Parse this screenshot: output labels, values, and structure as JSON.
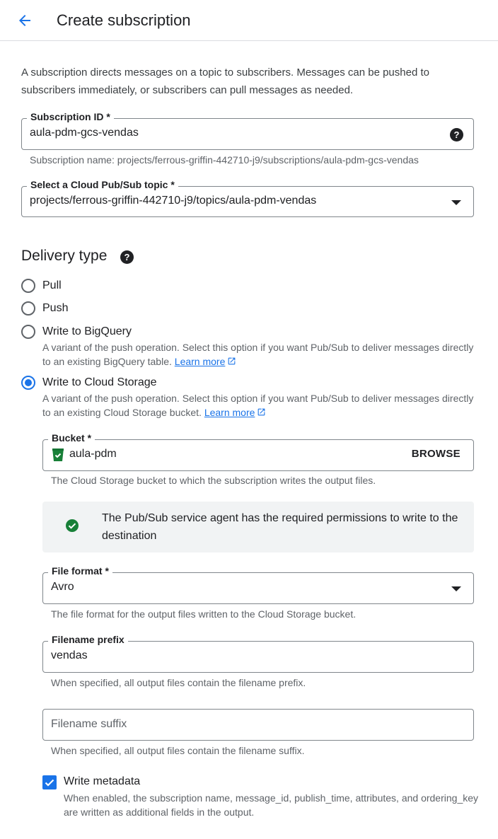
{
  "header": {
    "title": "Create subscription"
  },
  "intro": "A subscription directs messages on a topic to subscribers. Messages can be pushed to subscribers immediately, or subscribers can pull messages as needed.",
  "subscription_id": {
    "label": "Subscription ID *",
    "value": "aula-pdm-gcs-vendas",
    "hint": "Subscription name: projects/ferrous-griffin-442710-j9/subscriptions/aula-pdm-gcs-vendas"
  },
  "topic": {
    "label": "Select a Cloud Pub/Sub topic *",
    "value": "projects/ferrous-griffin-442710-j9/topics/aula-pdm-vendas"
  },
  "delivery": {
    "title": "Delivery type",
    "options": [
      {
        "label": "Pull",
        "checked": false
      },
      {
        "label": "Push",
        "checked": false
      },
      {
        "label": "Write to BigQuery",
        "checked": false,
        "description": "A variant of the push operation. Select this option if you want Pub/Sub to deliver messages directly to an existing BigQuery table.",
        "link": "Learn more"
      },
      {
        "label": "Write to Cloud Storage",
        "checked": true,
        "description": "A variant of the push operation. Select this option if you want Pub/Sub to deliver messages directly to an existing Cloud Storage bucket.",
        "link": "Learn more"
      }
    ]
  },
  "bucket": {
    "label": "Bucket *",
    "value": "aula-pdm",
    "browse": "BROWSE",
    "hint": "The Cloud Storage bucket to which the subscription writes the output files."
  },
  "notice": {
    "text": "The Pub/Sub service agent has the required permissions to write to the destination"
  },
  "file_format": {
    "label": "File format *",
    "value": "Avro",
    "hint": "The file format for the output files written to the Cloud Storage bucket."
  },
  "filename_prefix": {
    "label": "Filename prefix",
    "value": "vendas",
    "hint": "When specified, all output files contain the filename prefix."
  },
  "filename_suffix": {
    "placeholder": "Filename suffix",
    "hint": "When specified, all output files contain the filename suffix."
  },
  "write_metadata": {
    "label": "Write metadata",
    "checked": true,
    "description": "When enabled, the subscription name, message_id, publish_time, attributes, and ordering_key are written as additional fields in the output."
  },
  "colors": {
    "accent": "#1a73e8",
    "success": "#188038",
    "border": "#80868b",
    "notice_bg": "#f1f3f4"
  }
}
